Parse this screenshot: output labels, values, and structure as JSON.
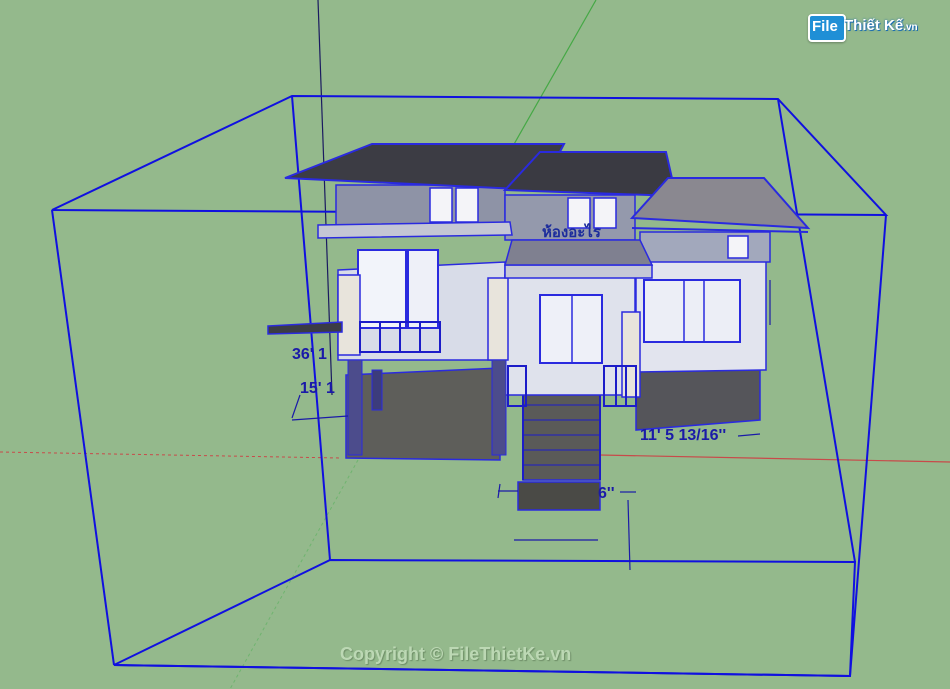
{
  "watermark": {
    "logo_file": "File",
    "logo_rest": "Thiết Kế",
    "logo_tld": ".vn",
    "copyright": "Copyright © FileThietKe.vn"
  },
  "model": {
    "sign_text": "ห้องอะไร"
  },
  "dimensions": {
    "dim_1": "36' 1",
    "dim_2": "15' 1",
    "dim_3": "11' 5 13/16''",
    "dim_4": "6''"
  },
  "colors": {
    "background": "#94b98c",
    "bounding_box": "#1010e0",
    "selection": "#2a2adf",
    "axis_red": "#c83c3c",
    "axis_green": "#46a046"
  }
}
